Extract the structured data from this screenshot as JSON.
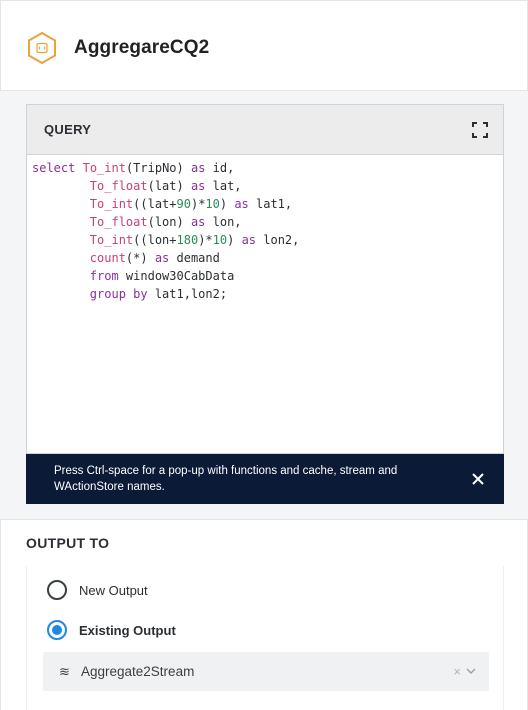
{
  "header": {
    "title": "AggregareCQ2",
    "icon": "cq-hexagon-icon",
    "accent": "#e8a33d"
  },
  "query": {
    "label": "QUERY",
    "expand_icon": "expand-icon",
    "code_lines": [
      [
        {
          "t": "select",
          "c": "kw"
        },
        {
          "t": " "
        },
        {
          "t": "To_int",
          "c": "fn"
        },
        {
          "t": "(TripNo) "
        },
        {
          "t": "as",
          "c": "kw"
        },
        {
          "t": " id,"
        }
      ],
      [
        {
          "t": "        "
        },
        {
          "t": "To_float",
          "c": "fn"
        },
        {
          "t": "(lat) "
        },
        {
          "t": "as",
          "c": "kw"
        },
        {
          "t": " lat,"
        }
      ],
      [
        {
          "t": "        "
        },
        {
          "t": "To_int",
          "c": "fn"
        },
        {
          "t": "((lat+"
        },
        {
          "t": "90",
          "c": "num"
        },
        {
          "t": ")*"
        },
        {
          "t": "10",
          "c": "num"
        },
        {
          "t": ") "
        },
        {
          "t": "as",
          "c": "kw"
        },
        {
          "t": " lat1,"
        }
      ],
      [
        {
          "t": "        "
        },
        {
          "t": "To_float",
          "c": "fn"
        },
        {
          "t": "(lon) "
        },
        {
          "t": "as",
          "c": "kw"
        },
        {
          "t": " lon,"
        }
      ],
      [
        {
          "t": "        "
        },
        {
          "t": "To_int",
          "c": "fn"
        },
        {
          "t": "((lon+"
        },
        {
          "t": "180",
          "c": "num"
        },
        {
          "t": ")*"
        },
        {
          "t": "10",
          "c": "num"
        },
        {
          "t": ") "
        },
        {
          "t": "as",
          "c": "kw"
        },
        {
          "t": " lon2,"
        }
      ],
      [
        {
          "t": "        "
        },
        {
          "t": "count",
          "c": "fn"
        },
        {
          "t": "(*) "
        },
        {
          "t": "as",
          "c": "kw"
        },
        {
          "t": " demand"
        }
      ],
      [
        {
          "t": "        "
        },
        {
          "t": "from",
          "c": "kw"
        },
        {
          "t": " window30CabData"
        }
      ],
      [
        {
          "t": "        "
        },
        {
          "t": "group by",
          "c": "kw"
        },
        {
          "t": " lat1,lon2;"
        }
      ]
    ]
  },
  "hint": {
    "text": "Press Ctrl-space for a pop-up with functions and cache, stream and WActionStore names.",
    "close_icon": "close-icon"
  },
  "output": {
    "title": "OUTPUT TO",
    "options": [
      {
        "label": "New Output",
        "selected": false
      },
      {
        "label": "Existing Output",
        "selected": true
      }
    ],
    "select": {
      "icon": "≋",
      "value": "Aggregate2Stream",
      "clear": "×"
    }
  }
}
